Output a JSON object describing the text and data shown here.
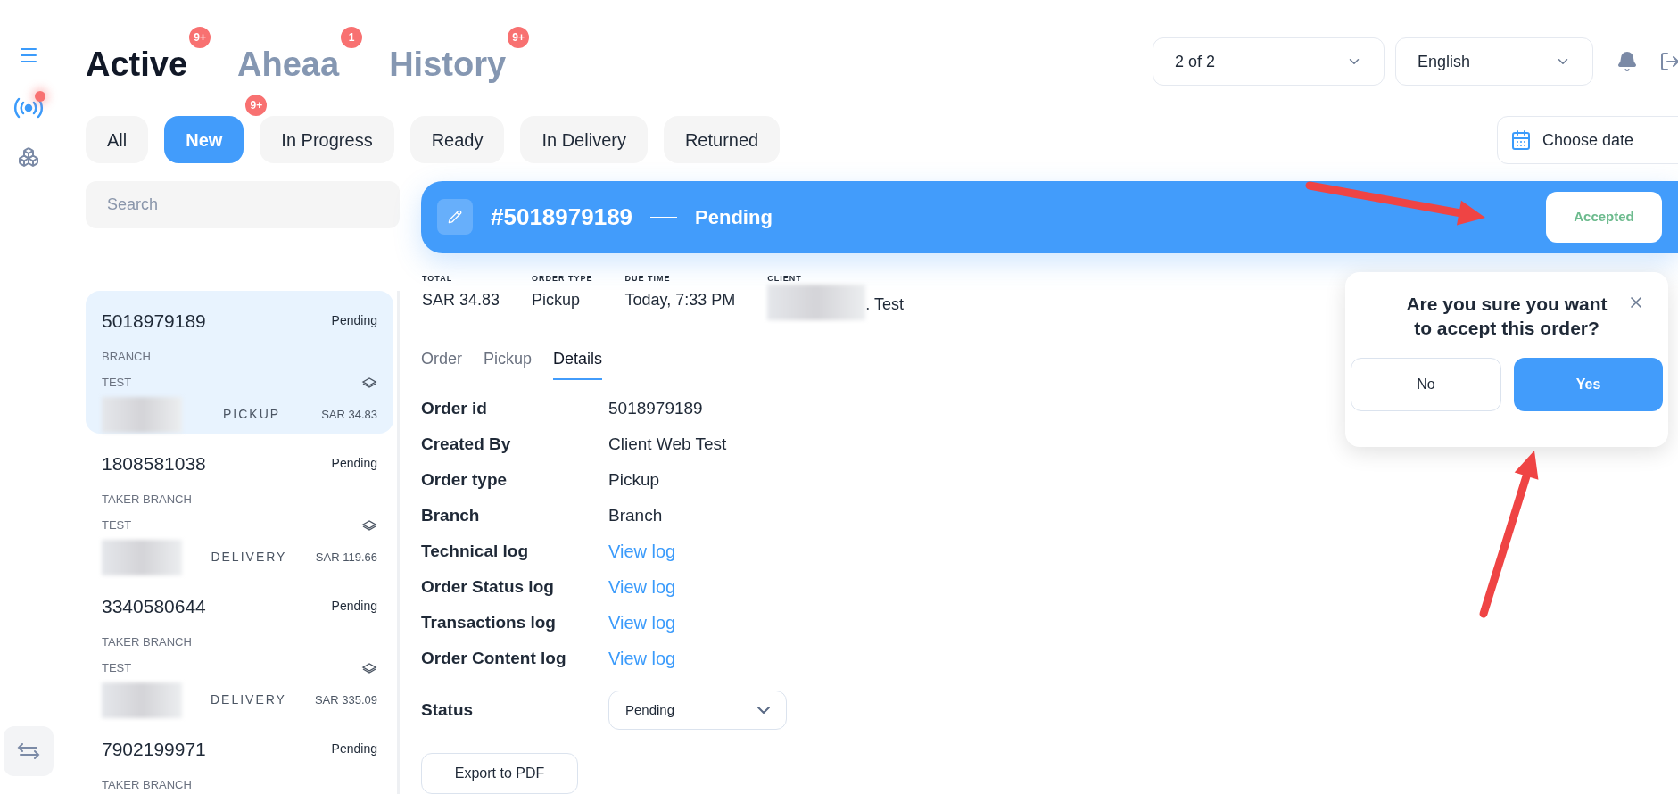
{
  "view_tabs": [
    {
      "label": "Active",
      "badge": "9+",
      "selected": true
    },
    {
      "label": "Aheaa",
      "badge": "1",
      "selected": false
    },
    {
      "label": "History",
      "badge": "9+",
      "selected": false
    }
  ],
  "top_controls": {
    "page_select": "2 of 2",
    "language_select": "English"
  },
  "filters": [
    {
      "label": "All",
      "selected": false
    },
    {
      "label": "New",
      "selected": true,
      "badge": "9+"
    },
    {
      "label": "In Progress",
      "selected": false
    },
    {
      "label": "Ready",
      "selected": false
    },
    {
      "label": "In Delivery",
      "selected": false
    },
    {
      "label": "Returned",
      "selected": false
    }
  ],
  "date_picker": {
    "label": "Choose date"
  },
  "search": {
    "placeholder": "Search"
  },
  "orders": [
    {
      "number": "5018979189",
      "status": "Pending",
      "branch": "BRANCH",
      "note": "TEST",
      "type": "PICKUP",
      "amount": "SAR 34.83",
      "selected": true
    },
    {
      "number": "1808581038",
      "status": "Pending",
      "branch": "TAKER BRANCH",
      "note": "TEST",
      "type": "DELIVERY",
      "amount": "SAR 119.66",
      "selected": false
    },
    {
      "number": "3340580644",
      "status": "Pending",
      "branch": "TAKER BRANCH",
      "note": "TEST",
      "type": "DELIVERY",
      "amount": "SAR 335.09",
      "selected": false
    },
    {
      "number": "7902199971",
      "status": "Pending",
      "branch": "TAKER BRANCH",
      "selected": false
    }
  ],
  "order_header": {
    "number": "#5018979189",
    "status": "Pending",
    "action": "Accepted"
  },
  "summary": [
    {
      "label": "TOTAL",
      "value": "SAR 34.83"
    },
    {
      "label": "ORDER TYPE",
      "value": "Pickup"
    },
    {
      "label": "DUE TIME",
      "value": "Today, 7:33 PM"
    },
    {
      "label": "CLIENT",
      "value": ". Test",
      "blurred": true
    }
  ],
  "detail_tabs": [
    {
      "label": "Order",
      "selected": false
    },
    {
      "label": "Pickup",
      "selected": false
    },
    {
      "label": "Details",
      "selected": true
    }
  ],
  "details": [
    {
      "label": "Order id",
      "value": "5018979189",
      "kind": "text"
    },
    {
      "label": "Created By",
      "value": "Client Web Test",
      "kind": "text"
    },
    {
      "label": "Order type",
      "value": "Pickup",
      "kind": "text"
    },
    {
      "label": "Branch",
      "value": "Branch",
      "kind": "text"
    },
    {
      "label": "Technical log",
      "value": "View log",
      "kind": "link"
    },
    {
      "label": "Order Status log",
      "value": "View log",
      "kind": "link"
    },
    {
      "label": "Transactions log",
      "value": "View log",
      "kind": "link"
    },
    {
      "label": "Order Content log",
      "value": "View log",
      "kind": "link"
    }
  ],
  "status_field": {
    "label": "Status",
    "value": "Pending"
  },
  "export_button": "Export to PDF",
  "confirm_dialog": {
    "message": "Are you sure you want to accept this order?",
    "buttons": [
      {
        "label": "No",
        "kind": "secondary"
      },
      {
        "label": "Yes",
        "kind": "primary"
      }
    ]
  }
}
